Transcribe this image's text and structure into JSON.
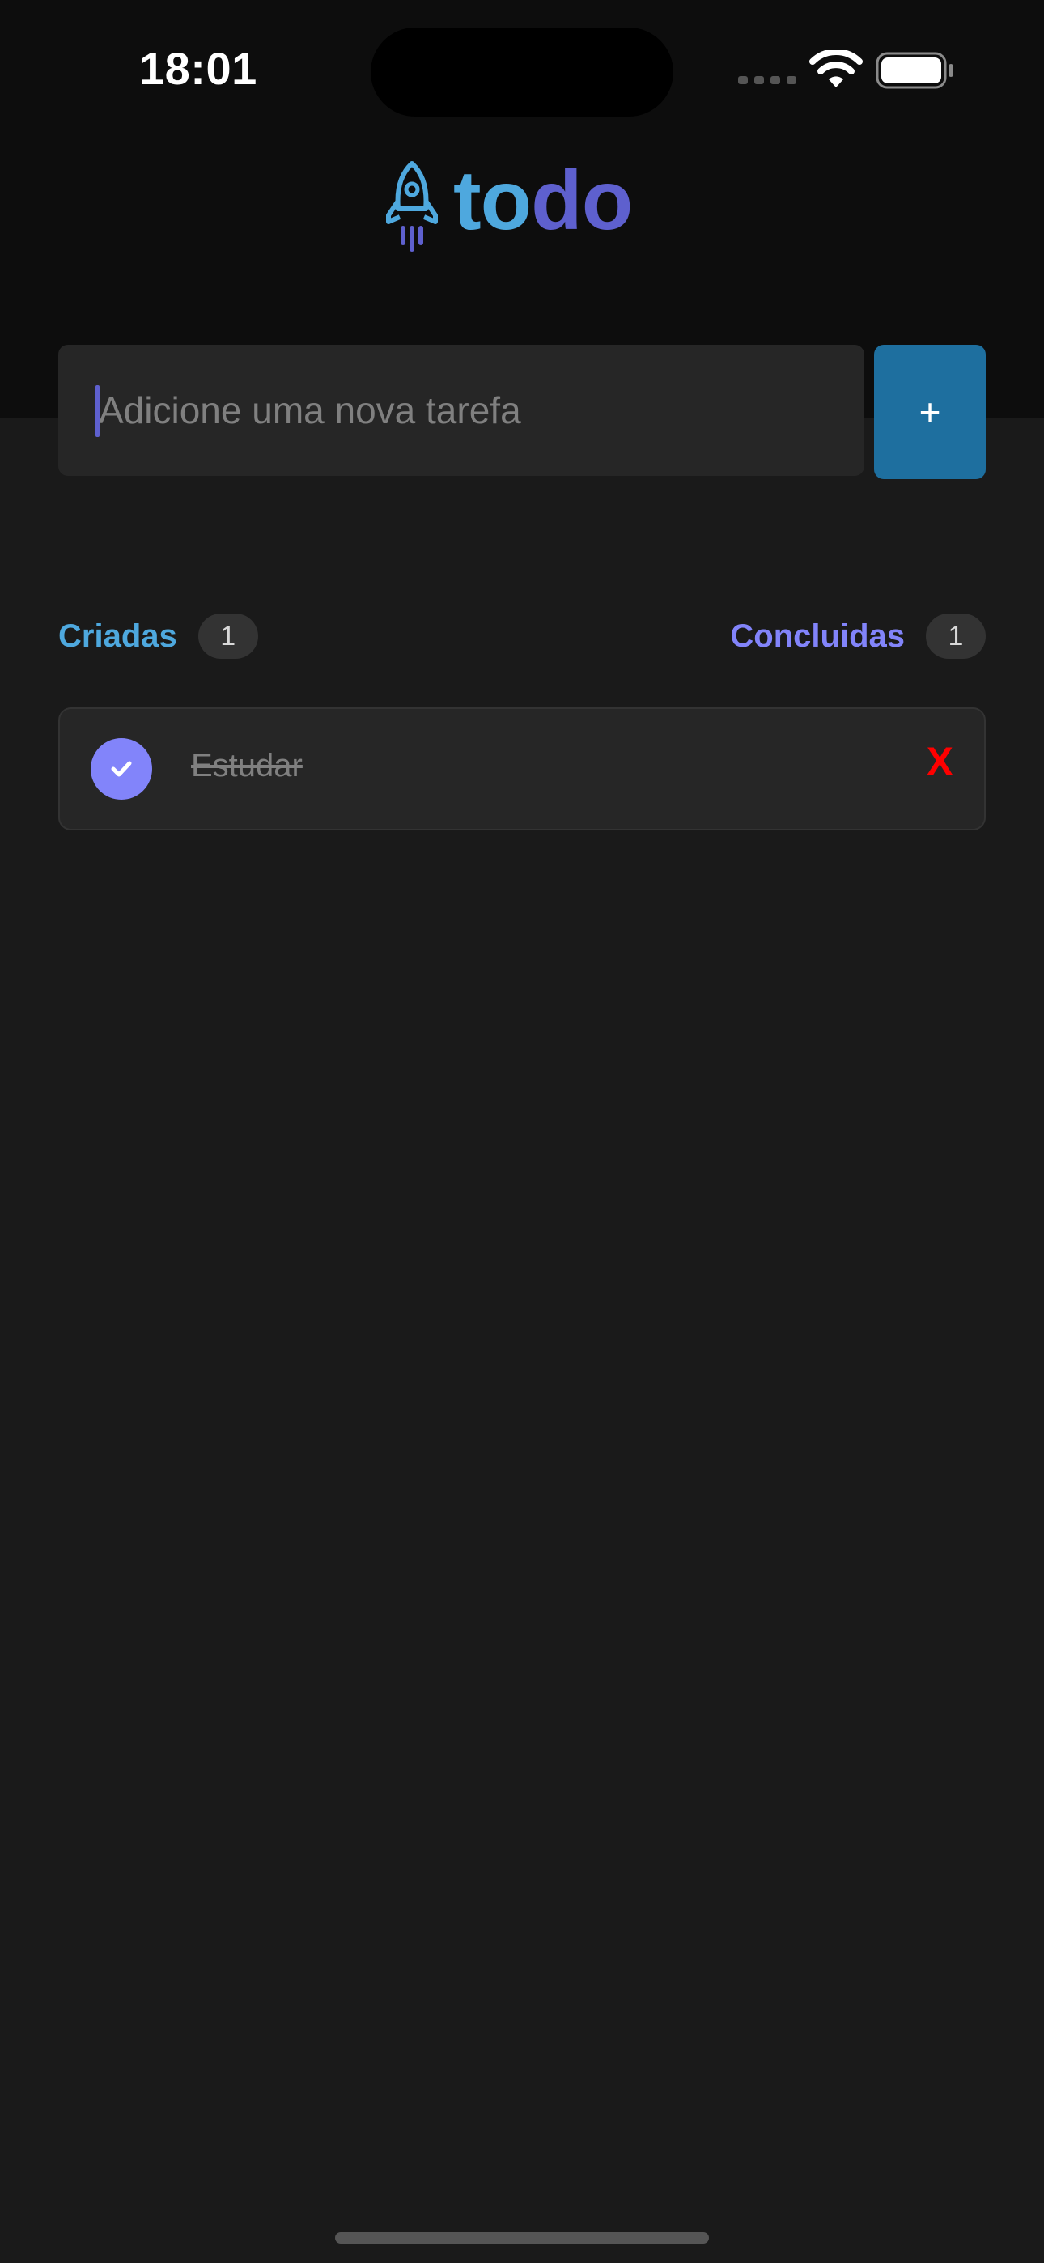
{
  "status_bar": {
    "time": "18:01"
  },
  "header": {
    "logo_text_part1": "to",
    "logo_text_part2": "do",
    "logo_icon": "rocket-icon"
  },
  "input": {
    "placeholder": "Adicione uma nova tarefa",
    "value": ""
  },
  "add_button": {
    "label": "+"
  },
  "counters": {
    "created_label": "Criadas",
    "created_count": "1",
    "done_label": "Concluidas",
    "done_count": "1"
  },
  "tasks": [
    {
      "text": "Estudar",
      "completed": true,
      "delete_label": "X"
    }
  ],
  "colors": {
    "accent_blue": "#4ea8de",
    "accent_purple": "#5e60ce",
    "checked": "#8284fa",
    "button": "#1e6f9f",
    "delete": "#ff0000"
  }
}
